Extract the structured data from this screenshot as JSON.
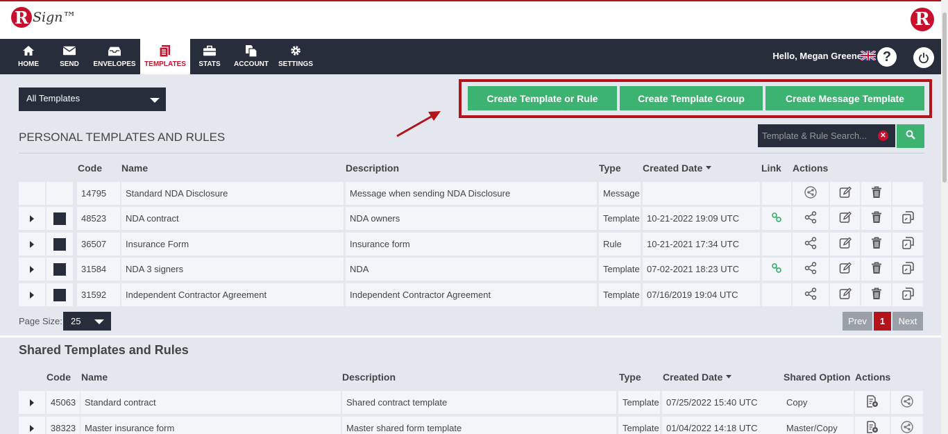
{
  "brand": {
    "logo_letter": "R",
    "logo_text": "Sign™",
    "logo_right_letter": "R"
  },
  "nav": {
    "items": [
      {
        "label": "HOME",
        "icon": "home-icon"
      },
      {
        "label": "SEND",
        "icon": "envelope-icon"
      },
      {
        "label": "ENVELOPES",
        "icon": "inbox-icon"
      },
      {
        "label": "TEMPLATES",
        "icon": "document-icon",
        "active": true
      },
      {
        "label": "STATS",
        "icon": "briefcase-icon"
      },
      {
        "label": "ACCOUNT",
        "icon": "copy-icon"
      },
      {
        "label": "SETTINGS",
        "icon": "gear-icon"
      }
    ],
    "greeting": "Hello, Megan Greene"
  },
  "filter": {
    "selected": "All Templates"
  },
  "actions": {
    "create_template": "Create Template or Rule",
    "create_group": "Create Template Group",
    "create_message": "Create Message Template"
  },
  "personal": {
    "title": "PERSONAL TEMPLATES AND RULES",
    "search_placeholder": "Template & Rule Search...",
    "columns": {
      "code": "Code",
      "name": "Name",
      "description": "Description",
      "type": "Type",
      "created": "Created Date",
      "link": "Link",
      "actions": "Actions"
    },
    "rows": [
      {
        "code": "14795",
        "name": "Standard NDA Disclosure",
        "description": "Message when sending NDA Disclosure",
        "type": "Message",
        "created": "",
        "link": false,
        "expandable": false
      },
      {
        "code": "48523",
        "name": "NDA contract",
        "description": "NDA owners",
        "type": "Template",
        "created": "10-21-2022 19:09 UTC",
        "link": true,
        "expandable": true
      },
      {
        "code": "36507",
        "name": "Insurance Form",
        "description": "Insurance form",
        "type": "Rule",
        "created": "10-21-2021 17:34 UTC",
        "link": false,
        "expandable": true
      },
      {
        "code": "31584",
        "name": "NDA 3 signers",
        "description": "NDA",
        "type": "Template",
        "created": "07-02-2021 18:23 UTC",
        "link": true,
        "expandable": true
      },
      {
        "code": "31592",
        "name": "Independent Contractor Agreement",
        "description": "Independent Contractor Agreement",
        "type": "Template",
        "created": "07/16/2019 19:04 UTC",
        "link": false,
        "expandable": true
      }
    ],
    "page_size_label": "Page Size:",
    "page_size": "25",
    "pagination": {
      "prev": "Prev",
      "current": "1",
      "next": "Next"
    }
  },
  "shared": {
    "title": "Shared Templates and Rules",
    "columns": {
      "code": "Code",
      "name": "Name",
      "description": "Description",
      "type": "Type",
      "created": "Created Date",
      "shared_option": "Shared Option",
      "actions": "Actions"
    },
    "rows": [
      {
        "code": "45063",
        "name": "Standard contract",
        "description": "Shared contract template",
        "type": "Template",
        "created": "07/25/2022 15:40 UTC",
        "shared_option": "Copy"
      },
      {
        "code": "38323",
        "name": "Master insurance form",
        "description": "Master shared form template",
        "type": "Template",
        "created": "01/04/2022 14:18 UTC",
        "shared_option": "Master/Copy"
      }
    ]
  },
  "colors": {
    "accent_red": "#c8102e",
    "green": "#3cb371",
    "navy": "#272d3a"
  }
}
